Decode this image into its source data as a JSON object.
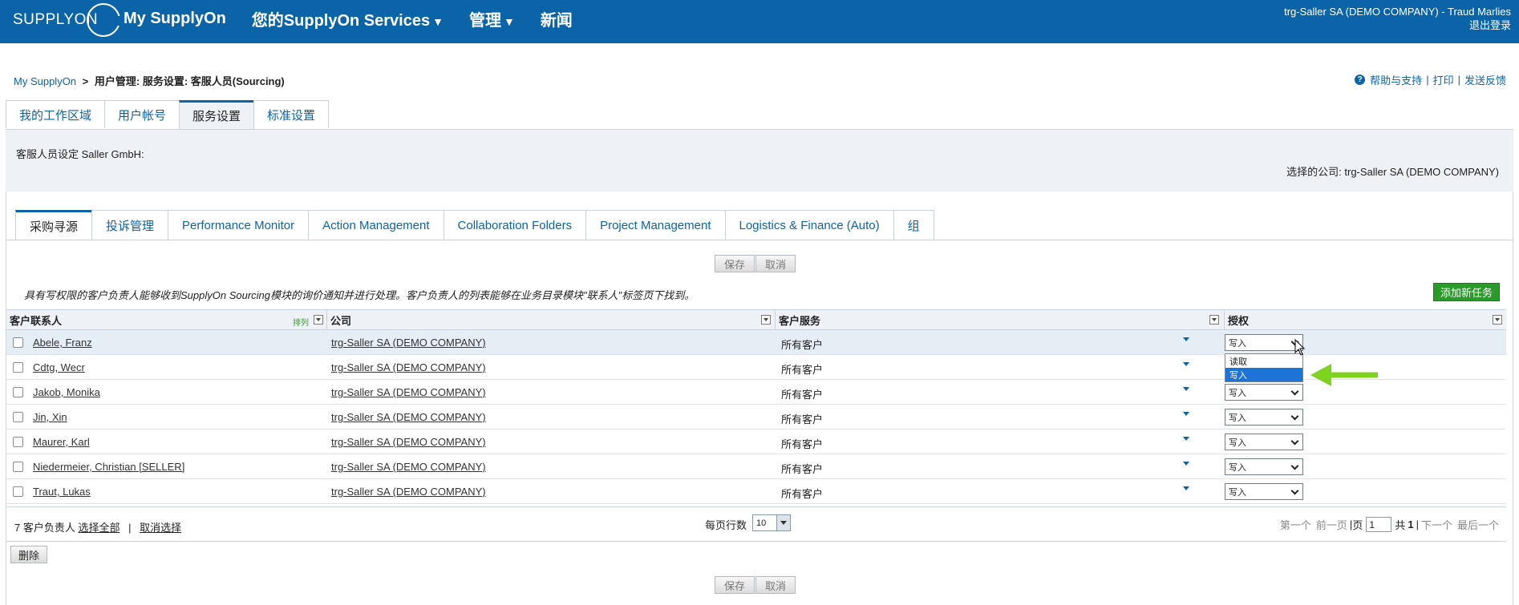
{
  "header": {
    "logo_text": "SUPPLYON",
    "nav": [
      {
        "label": "My SupplyOn",
        "caret": ""
      },
      {
        "label": "您的SupplyOn Services",
        "caret": "▼"
      },
      {
        "label": "管理",
        "caret": "▼"
      },
      {
        "label": "新闻",
        "caret": ""
      }
    ],
    "user": "trg-Saller SA (DEMO COMPANY) - Traud Marlies",
    "logout": "退出登录"
  },
  "breadcrumb": {
    "root": "My SupplyOn",
    "sep": ">",
    "current": "用户管理: 服务设置: 客服人员(Sourcing)"
  },
  "help": {
    "icon": "?",
    "help": "帮助与支持",
    "sep": "|",
    "print": "打印",
    "feedback": "发送反馈"
  },
  "main_tabs": [
    {
      "label": "我的工作区域",
      "active": false
    },
    {
      "label": "用户帐号",
      "active": false
    },
    {
      "label": "服务设置",
      "active": true
    },
    {
      "label": "标准设置",
      "active": false
    }
  ],
  "panel": {
    "description": "客服人员设定 Saller GmbH:",
    "selected_company": "选择的公司: trg-Saller SA (DEMO COMPANY)"
  },
  "service_tabs": [
    {
      "label": "采购寻源",
      "active": true
    },
    {
      "label": "投诉管理",
      "active": false
    },
    {
      "label": "Performance Monitor",
      "active": false
    },
    {
      "label": "Action Management",
      "active": false
    },
    {
      "label": "Collaboration Folders",
      "active": false
    },
    {
      "label": "Project Management",
      "active": false
    },
    {
      "label": "Logistics & Finance (Auto)",
      "active": false
    },
    {
      "label": "组",
      "active": false
    }
  ],
  "buttons": {
    "save": "保存",
    "cancel": "取消",
    "add_task": "添加新任务",
    "delete": "删除"
  },
  "info_text": "具有写权限的客户负责人能够收到SupplyOn Sourcing模块的询价通知并进行处理。客户负责人的列表能够在业务目录模块\"联系人\"标签页下找到。",
  "table": {
    "columns": {
      "contact": "客户联系人",
      "sort": "排列",
      "company": "公司",
      "service": "客户服务",
      "permission": "授权"
    },
    "rows": [
      {
        "name": "Abele, Franz",
        "company": "trg-Saller SA (DEMO COMPANY)",
        "service": "所有客户",
        "permission": "写入"
      },
      {
        "name": "Cdtg, Wecr",
        "company": "trg-Saller SA (DEMO COMPANY)",
        "service": "所有客户",
        "permission": "写入"
      },
      {
        "name": "Jakob, Monika",
        "company": "trg-Saller SA (DEMO COMPANY)",
        "service": "所有客户",
        "permission": "写入"
      },
      {
        "name": "Jin, Xin",
        "company": "trg-Saller SA (DEMO COMPANY)",
        "service": "所有客户",
        "permission": "写入"
      },
      {
        "name": "Maurer, Karl",
        "company": "trg-Saller SA (DEMO COMPANY)",
        "service": "所有客户",
        "permission": "写入"
      },
      {
        "name": "Niedermeier, Christian [SELLER]",
        "company": "trg-Saller SA (DEMO COMPANY)",
        "service": "所有客户",
        "permission": "写入"
      },
      {
        "name": "Traut, Lukas",
        "company": "trg-Saller SA (DEMO COMPANY)",
        "service": "所有客户",
        "permission": "写入"
      }
    ],
    "dropdown_options": [
      "读取",
      "写入"
    ],
    "dropdown_selected": "写入"
  },
  "footer": {
    "count": "7 客户负责人",
    "select_all": "选择全部",
    "pipe": "|",
    "deselect": "取消选择",
    "rows_per_page_label": "每页行数",
    "rows_per_page": "10",
    "first": "第一个",
    "prev": "前一页",
    "page_label": "页",
    "page_value": "1",
    "of_label": "共",
    "total_pages": "1",
    "next": "下一个",
    "last": "最后一个"
  },
  "colors": {
    "brand_blue": "#0b64a8",
    "add_green": "#2a9a2a",
    "arrow_green": "#7ed321",
    "selected_option": "#1e74d6"
  },
  "icons": {
    "logo": "supplyon-logo",
    "cursor": "mouse-pointer-icon",
    "arrow": "green-arrow-icon"
  }
}
